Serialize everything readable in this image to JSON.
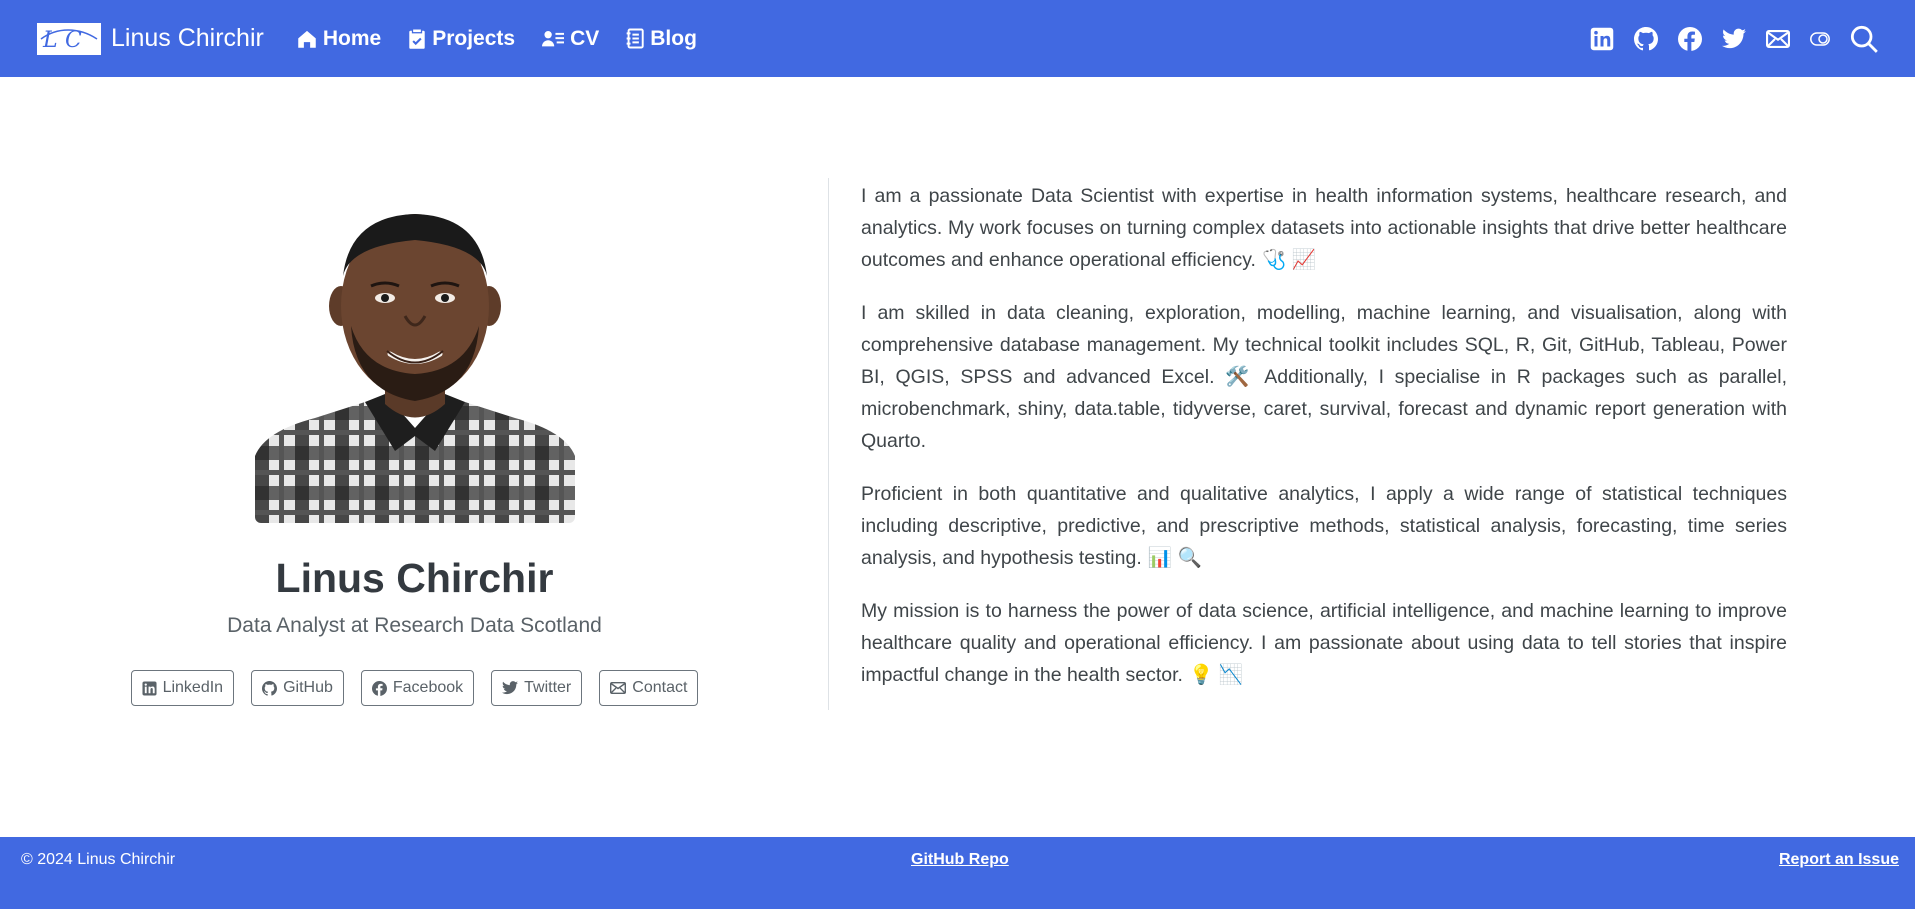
{
  "colors": {
    "nav_bg": "#4169e1",
    "text": "#343a40"
  },
  "navbar": {
    "brand_title": "Linus Chirchir",
    "brand_logo_icon": "lc-monogram-logo",
    "links": [
      {
        "label": "Home",
        "icon": "house-icon"
      },
      {
        "label": "Projects",
        "icon": "clipboard-icon"
      },
      {
        "label": "CV",
        "icon": "person-lines-icon"
      },
      {
        "label": "Blog",
        "icon": "journal-icon"
      }
    ],
    "right_icons": [
      "linkedin-icon",
      "github-icon",
      "facebook-icon",
      "twitter-icon",
      "envelope-icon",
      "toggle-icon",
      "search-icon"
    ]
  },
  "profile": {
    "name": "Linus Chirchir",
    "subtitle": "Data Analyst at Research Data Scotland",
    "social_buttons": [
      {
        "label": "LinkedIn",
        "icon": "linkedin-icon"
      },
      {
        "label": "GitHub",
        "icon": "github-icon"
      },
      {
        "label": "Facebook",
        "icon": "facebook-icon"
      },
      {
        "label": "Twitter",
        "icon": "twitter-icon"
      },
      {
        "label": "Contact",
        "icon": "envelope-icon"
      }
    ]
  },
  "bio": {
    "paragraphs": [
      {
        "text": "I am a passionate Data Scientist with expertise in health information systems, healthcare research, and analytics. My work focuses on turning complex datasets into actionable insights that drive better healthcare outcomes and enhance operational efficiency.",
        "emoji": "🩺 📈"
      },
      {
        "text": "I am skilled in data cleaning, exploration, modelling, machine learning, and visualisation, along with comprehensive database management. My technical toolkit includes SQL, R, Git, GitHub, Tableau, Power BI, QGIS, SPSS and advanced Excel. 🛠️  Additionally, I specialise in R packages such as parallel, microbenchmark, shiny, data.table, tidyverse, caret, survival, forecast and dynamic report generation with Quarto.",
        "emoji": ""
      },
      {
        "text": "Proficient in both quantitative and qualitative analytics, I apply a wide range of statistical techniques including descriptive, predictive, and prescriptive methods, statistical analysis, forecasting, time series analysis, and hypothesis testing.",
        "emoji": "📊 🔍"
      },
      {
        "text": "My mission is to harness the power of data science, artificial intelligence, and machine learning to improve healthcare quality and operational efficiency. I am passionate about using data to tell stories that inspire impactful change in the health sector.",
        "emoji": "💡 📉"
      }
    ]
  },
  "footer": {
    "copyright": "© 2024 Linus Chirchir",
    "repo_link": "GitHub Repo",
    "issue_link": "Report an Issue"
  }
}
